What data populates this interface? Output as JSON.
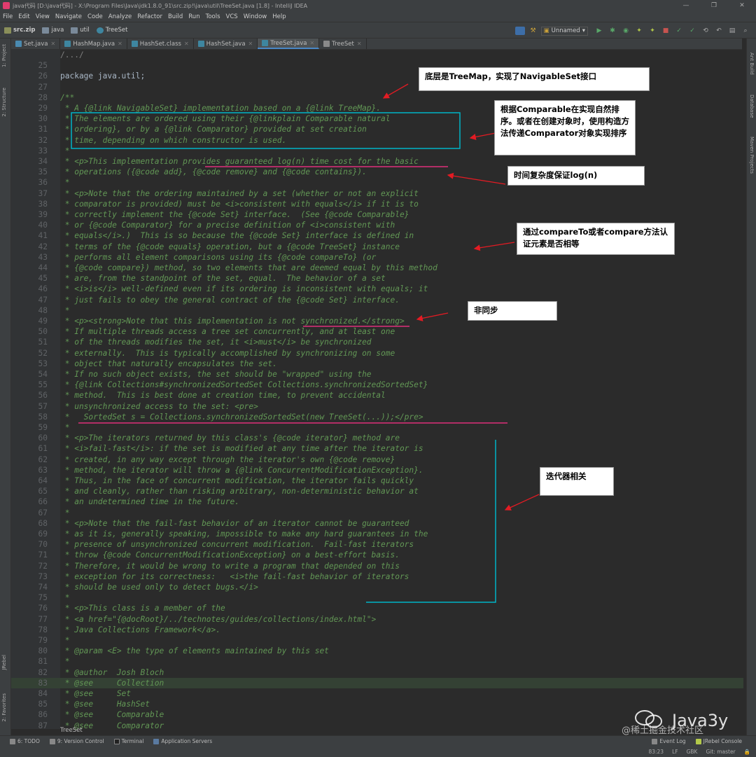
{
  "window": {
    "title": "java代码 [D:\\java代码] - X:\\Program Files\\Java\\jdk1.8.0_91\\src.zip!\\java\\util\\TreeSet.java [1.8] - IntelliJ IDEA",
    "controls": [
      "—",
      "❐",
      "✕"
    ]
  },
  "menu": [
    "File",
    "Edit",
    "View",
    "Navigate",
    "Code",
    "Analyze",
    "Refactor",
    "Build",
    "Run",
    "Tools",
    "VCS",
    "Window",
    "Help"
  ],
  "breadcrumbs": [
    "src.zip",
    "java",
    "util",
    "TreeSet"
  ],
  "run_config": "Unnamed",
  "tabs": [
    {
      "label": "Set.java"
    },
    {
      "label": "HashMap.java"
    },
    {
      "label": "HashSet.class"
    },
    {
      "label": "HashSet.java"
    },
    {
      "label": "TreeSet.java"
    },
    {
      "label": "TreeSet"
    }
  ],
  "left_tools": [
    "1: Project",
    "2: Structure",
    "JRebel",
    "2: Favorites"
  ],
  "right_tools": [
    "Ant Build",
    "Database",
    "Maven Projects"
  ],
  "lines": [
    {
      "n": "",
      "t": "/.../"
    },
    {
      "n": "25",
      "t": ""
    },
    {
      "n": "26",
      "t": "package java.util;"
    },
    {
      "n": "27",
      "t": ""
    },
    {
      "n": "28",
      "t": "/**"
    },
    {
      "n": "29",
      "t": " * A {@link NavigableSet} implementation based on a {@link TreeMap}."
    },
    {
      "n": "30",
      "t": " * The elements are ordered using their {@linkplain Comparable natural"
    },
    {
      "n": "31",
      "t": " * ordering}, or by a {@link Comparator} provided at set creation"
    },
    {
      "n": "32",
      "t": " * time, depending on which constructor is used."
    },
    {
      "n": "33",
      "t": " *"
    },
    {
      "n": "34",
      "t": " * <p>This implementation provides guaranteed log(n) time cost for the basic"
    },
    {
      "n": "35",
      "t": " * operations ({@code add}, {@code remove} and {@code contains})."
    },
    {
      "n": "36",
      "t": " *"
    },
    {
      "n": "37",
      "t": " * <p>Note that the ordering maintained by a set (whether or not an explicit"
    },
    {
      "n": "38",
      "t": " * comparator is provided) must be <i>consistent with equals</i> if it is to"
    },
    {
      "n": "39",
      "t": " * correctly implement the {@code Set} interface.  (See {@code Comparable}"
    },
    {
      "n": "40",
      "t": " * or {@code Comparator} for a precise definition of <i>consistent with"
    },
    {
      "n": "41",
      "t": " * equals</i>.)  This is so because the {@code Set} interface is defined in"
    },
    {
      "n": "42",
      "t": " * terms of the {@code equals} operation, but a {@code TreeSet} instance"
    },
    {
      "n": "43",
      "t": " * performs all element comparisons using its {@code compareTo} (or"
    },
    {
      "n": "44",
      "t": " * {@code compare}) method, so two elements that are deemed equal by this method"
    },
    {
      "n": "45",
      "t": " * are, from the standpoint of the set, equal.  The behavior of a set"
    },
    {
      "n": "46",
      "t": " * <i>is</i> well-defined even if its ordering is inconsistent with equals; it"
    },
    {
      "n": "47",
      "t": " * just fails to obey the general contract of the {@code Set} interface."
    },
    {
      "n": "48",
      "t": " *"
    },
    {
      "n": "49",
      "t": " * <p><strong>Note that this implementation is not synchronized.</strong>"
    },
    {
      "n": "50",
      "t": " * If multiple threads access a tree set concurrently, and at least one"
    },
    {
      "n": "51",
      "t": " * of the threads modifies the set, it <i>must</i> be synchronized"
    },
    {
      "n": "52",
      "t": " * externally.  This is typically accomplished by synchronizing on some"
    },
    {
      "n": "53",
      "t": " * object that naturally encapsulates the set."
    },
    {
      "n": "54",
      "t": " * If no such object exists, the set should be \"wrapped\" using the"
    },
    {
      "n": "55",
      "t": " * {@link Collections#synchronizedSortedSet Collections.synchronizedSortedSet}"
    },
    {
      "n": "56",
      "t": " * method.  This is best done at creation time, to prevent accidental"
    },
    {
      "n": "57",
      "t": " * unsynchronized access to the set: <pre>"
    },
    {
      "n": "58",
      "t": " *   SortedSet s = Collections.synchronizedSortedSet(new TreeSet(...));</pre>"
    },
    {
      "n": "59",
      "t": " *"
    },
    {
      "n": "60",
      "t": " * <p>The iterators returned by this class's {@code iterator} method are"
    },
    {
      "n": "61",
      "t": " * <i>fail-fast</i>: if the set is modified at any time after the iterator is"
    },
    {
      "n": "62",
      "t": " * created, in any way except through the iterator's own {@code remove}"
    },
    {
      "n": "63",
      "t": " * method, the iterator will throw a {@link ConcurrentModificationException}."
    },
    {
      "n": "64",
      "t": " * Thus, in the face of concurrent modification, the iterator fails quickly"
    },
    {
      "n": "65",
      "t": " * and cleanly, rather than risking arbitrary, non-deterministic behavior at"
    },
    {
      "n": "66",
      "t": " * an undetermined time in the future."
    },
    {
      "n": "67",
      "t": " *"
    },
    {
      "n": "68",
      "t": " * <p>Note that the fail-fast behavior of an iterator cannot be guaranteed"
    },
    {
      "n": "69",
      "t": " * as it is, generally speaking, impossible to make any hard guarantees in the"
    },
    {
      "n": "70",
      "t": " * presence of unsynchronized concurrent modification.  Fail-fast iterators"
    },
    {
      "n": "71",
      "t": " * throw {@code ConcurrentModificationException} on a best-effort basis."
    },
    {
      "n": "72",
      "t": " * Therefore, it would be wrong to write a program that depended on this"
    },
    {
      "n": "73",
      "t": " * exception for its correctness:   <i>the fail-fast behavior of iterators"
    },
    {
      "n": "74",
      "t": " * should be used only to detect bugs.</i>"
    },
    {
      "n": "75",
      "t": " *"
    },
    {
      "n": "76",
      "t": " * <p>This class is a member of the"
    },
    {
      "n": "77",
      "t": " * <a href=\"{@docRoot}/../technotes/guides/collections/index.html\">"
    },
    {
      "n": "78",
      "t": " * Java Collections Framework</a>."
    },
    {
      "n": "79",
      "t": " *"
    },
    {
      "n": "80",
      "t": " * @param <E> the type of elements maintained by this set"
    },
    {
      "n": "81",
      "t": " *"
    },
    {
      "n": "82",
      "t": " * @author  Josh Bloch"
    },
    {
      "n": "83",
      "t": " * @see     Collection"
    },
    {
      "n": "84",
      "t": " * @see     Set"
    },
    {
      "n": "85",
      "t": " * @see     HashSet"
    },
    {
      "n": "86",
      "t": " * @see     Comparable"
    },
    {
      "n": "87",
      "t": " * @see     Comparator"
    }
  ],
  "annotations": [
    {
      "id": "a1",
      "text": "底层是TreeMap，实现了NavigableSet接口"
    },
    {
      "id": "a2",
      "text": "根据Comparable在实现自然排序。或者在创建对象时，使用构造方法传递Comparator对象实现排序"
    },
    {
      "id": "a3",
      "text": "时间复杂度保证log(n)"
    },
    {
      "id": "a4",
      "text": "通过compareTo或者compare方法认证元素是否相等"
    },
    {
      "id": "a5",
      "text": "非同步"
    },
    {
      "id": "a6",
      "text": "迭代器相关"
    }
  ],
  "bottom_tabs": [
    "6: TODO",
    "9: Version Control",
    "Terminal",
    "Application Servers"
  ],
  "bottom_right": [
    "Event Log",
    "JRebel Console"
  ],
  "editor_breadcrumb": "TreeSet",
  "status": {
    "position": "83:23",
    "line_sep": "LF",
    "encoding": "GBK",
    "git": "Git: master"
  },
  "watermark": {
    "brand": "Java3y",
    "sub": "@稀土掘金技术社区"
  },
  "colors": {
    "annot_red": "#e31b23",
    "box_cyan": "#00b4c8",
    "underline": "#e0307a"
  }
}
